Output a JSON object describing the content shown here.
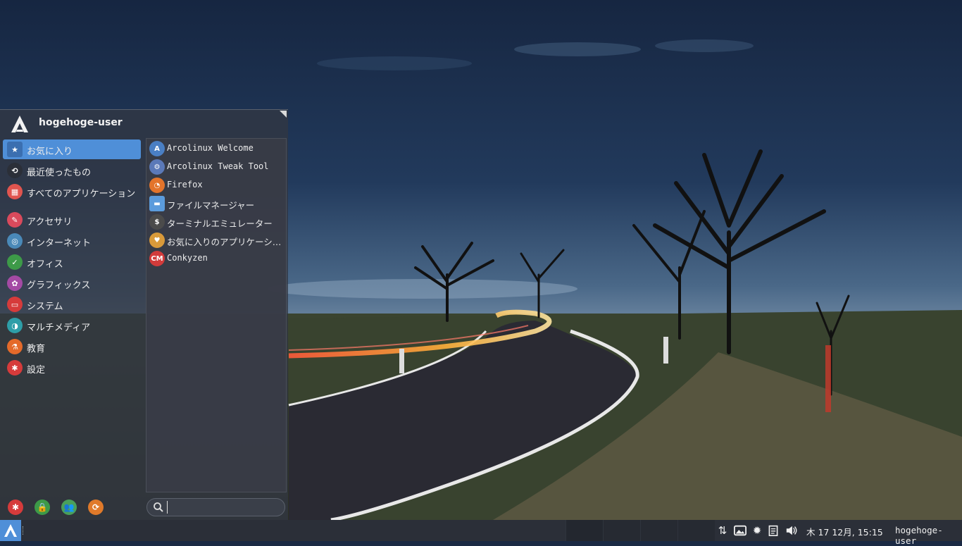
{
  "menu": {
    "username": "hogehoge-user",
    "categories": [
      {
        "label": "お気に入り",
        "icon": "favorites-icon",
        "color": "#4f8fd8",
        "active": true
      },
      {
        "label": "最近使ったもの",
        "icon": "recent-icon",
        "color": "#2b2f38"
      },
      {
        "label": "すべてのアプリケーション",
        "icon": "all-apps-icon",
        "color": "#e0554f"
      },
      {
        "label": "アクセサリ",
        "icon": "accessories-icon",
        "color": "#d94a5c"
      },
      {
        "label": "インターネット",
        "icon": "internet-icon",
        "color": "#4a89b8"
      },
      {
        "label": "オフィス",
        "icon": "office-icon",
        "color": "#3d9a48"
      },
      {
        "label": "グラフィックス",
        "icon": "graphics-icon",
        "color": "#a44aa4"
      },
      {
        "label": "システム",
        "icon": "system-icon",
        "color": "#d63b3b"
      },
      {
        "label": "マルチメディア",
        "icon": "multimedia-icon",
        "color": "#2e9ea8"
      },
      {
        "label": "教育",
        "icon": "education-icon",
        "color": "#e46a2a"
      },
      {
        "label": "設定",
        "icon": "settings-icon",
        "color": "#d63b3b"
      }
    ],
    "apps": [
      {
        "label": "Arcolinux Welcome",
        "icon": "arcolinux-welcome-icon",
        "color": "#4a7fc4"
      },
      {
        "label": "Arcolinux Tweak Tool",
        "icon": "arcolinux-tweak-tool-icon",
        "color": "#5b79b8"
      },
      {
        "label": "Firefox",
        "icon": "firefox-icon",
        "color": "#e3742b"
      },
      {
        "label": "ファイルマネージャー",
        "icon": "file-manager-icon",
        "color": "#5b9bdc"
      },
      {
        "label": "ターミナルエミュレーター",
        "icon": "terminal-icon",
        "color": "#4b4b4b"
      },
      {
        "label": "お気に入りのアプリケーション",
        "icon": "favorite-apps-icon",
        "color": "#d99a3a"
      },
      {
        "label": "Conkyzen",
        "icon": "conkyzen-icon",
        "color": "#d23b3b"
      }
    ],
    "actions": [
      {
        "name": "settings-manager-icon",
        "color": "#d63b3b",
        "glyph": "✱"
      },
      {
        "name": "lock-screen-icon",
        "color": "#3d9a48",
        "glyph": "🔒"
      },
      {
        "name": "switch-user-icon",
        "color": "#4aa05a",
        "glyph": "👥"
      },
      {
        "name": "logout-icon",
        "color": "#e07a2a",
        "glyph": "⟳"
      }
    ],
    "search": {
      "value": "",
      "placeholder": ""
    }
  },
  "panel": {
    "clock": "木 17 12月, 15:15",
    "user": "hogehoge-user",
    "tray": [
      "network-icon",
      "screenshot-icon",
      "updates-icon",
      "clipboard-icon",
      "volume-icon"
    ]
  }
}
